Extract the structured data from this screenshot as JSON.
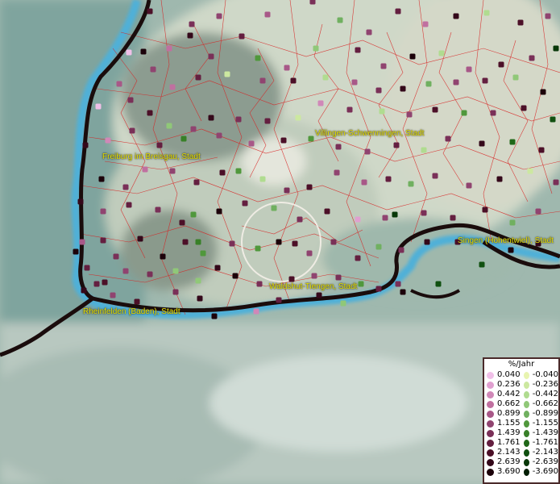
{
  "cities": [
    {
      "name": "Freiburg im Breisgau, Stadt"
    },
    {
      "name": "Villingen-Schwenningen, Stadt"
    },
    {
      "name": "Singen (Hohentwiel), Stadt"
    },
    {
      "name": "Waldshut-Tiengen, Stadt"
    },
    {
      "name": "Rheinfelden (Baden), Stadt"
    }
  ],
  "legend": {
    "title": "%/Jahr",
    "rows": [
      {
        "pos": "0.040",
        "neg": "-0.040",
        "pos_color": "#f0c0e8",
        "neg_color": "#e8f4b0"
      },
      {
        "pos": "0.236",
        "neg": "-0.236",
        "pos_color": "#e0a0d0",
        "neg_color": "#cce8a0"
      },
      {
        "pos": "0.442",
        "neg": "-0.442",
        "pos_color": "#d088b8",
        "neg_color": "#b0dc90"
      },
      {
        "pos": "0.662",
        "neg": "-0.662",
        "pos_color": "#c070a0",
        "neg_color": "#90c878"
      },
      {
        "pos": "0.899",
        "neg": "-0.899",
        "pos_color": "#a85888",
        "neg_color": "#70b060"
      },
      {
        "pos": "1.155",
        "neg": "-1.155",
        "pos_color": "#904470",
        "neg_color": "#50983c"
      },
      {
        "pos": "1.439",
        "neg": "-1.439",
        "pos_color": "#7a3058",
        "neg_color": "#388028"
      },
      {
        "pos": "1.761",
        "neg": "-1.761",
        "pos_color": "#641f40",
        "neg_color": "#206818"
      },
      {
        "pos": "2.143",
        "neg": "-2.143",
        "pos_color": "#4c1028",
        "neg_color": "#105010"
      },
      {
        "pos": "2.639",
        "neg": "-2.639",
        "pos_color": "#34081a",
        "neg_color": "#083808"
      },
      {
        "pos": "3.690",
        "neg": "-3.690",
        "pos_color": "#1c020a",
        "neg_color": "#021e04"
      }
    ]
  }
}
